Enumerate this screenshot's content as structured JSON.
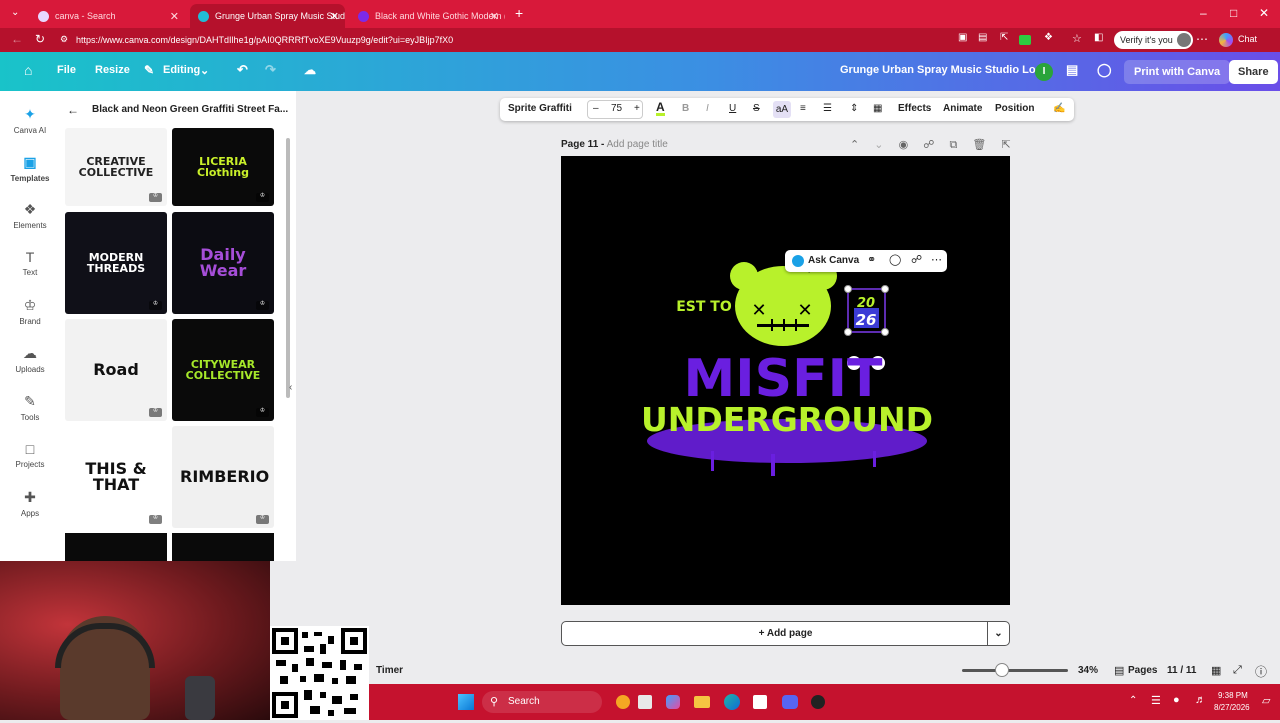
{
  "browser": {
    "tabs": [
      {
        "title": "canva - Search",
        "active": false,
        "favicon_color": "#e8d6ff"
      },
      {
        "title": "Grunge Urban Spray Music Studio Lo",
        "active": true,
        "favicon_color": "#21bcd6"
      },
      {
        "title": "Black and White Gothic Modern (",
        "active": false,
        "favicon_color": "#7d2ae8"
      }
    ],
    "new_tab_icon": "+",
    "url": "https://www.canva.com/design/DAHTdIlhe1g/pAI0QRRRfTvoXE9Vuuzp9g/edit?ui=eyJBIjp7fX0",
    "verify_label": "Verify it's you",
    "chat_label": "Chat"
  },
  "header": {
    "file": "File",
    "resize": "Resize",
    "editing": "Editing",
    "title": "Grunge Urban Spray Music Studio Logo",
    "avatar_initial": "I",
    "print": "Print with Canva",
    "share": "Share"
  },
  "rail": [
    {
      "label": "Canva AI",
      "icon": "canva-ai-icon"
    },
    {
      "label": "Templates",
      "icon": "templates-icon"
    },
    {
      "label": "Elements",
      "icon": "elements-icon"
    },
    {
      "label": "Text",
      "icon": "text-icon"
    },
    {
      "label": "Brand",
      "icon": "brand-icon"
    },
    {
      "label": "Uploads",
      "icon": "uploads-icon"
    },
    {
      "label": "Tools",
      "icon": "tools-icon"
    },
    {
      "label": "Projects",
      "icon": "projects-icon"
    },
    {
      "label": "Apps",
      "icon": "apps-icon"
    }
  ],
  "panel": {
    "title": "Black and Neon Green Graffiti Street Fa...",
    "thumbs": [
      {
        "text": "CREATIVE COLLECTIVE",
        "bg": "#f4f4f4",
        "fg": "#222222"
      },
      {
        "text": "LICERIA Clothing",
        "bg": "#0a0a0a",
        "fg": "#c9f02a"
      },
      {
        "text": "MODERN THREADS",
        "bg": "#101018",
        "fg": "#ffffff"
      },
      {
        "text": "Daily Wear",
        "bg": "#0c0c12",
        "fg": "#a64ed8"
      },
      {
        "text": "Road",
        "bg": "#f2f2f2",
        "fg": "#111111"
      },
      {
        "text": "CITYWEAR COLLECTIVE",
        "bg": "#0a0a0a",
        "fg": "#a6e82a"
      },
      {
        "text": "THIS & THAT",
        "bg": "#ffffff",
        "fg": "#111111"
      },
      {
        "text": "RIMBERIO",
        "bg": "#f0f0f0",
        "fg": "#111111"
      }
    ]
  },
  "toolbar": {
    "font": "Sprite Graffiti",
    "size": "75",
    "minus": "–",
    "plus": "+",
    "effects": "Effects",
    "animate": "Animate",
    "position": "Position"
  },
  "page": {
    "label": "Page 11 -",
    "title_placeholder": "Add page title",
    "add_page": "+ Add page"
  },
  "design": {
    "est": "EST TO",
    "year_top": "20",
    "year_bottom": "26",
    "misfit": "MISFIT",
    "underground": "UNDERGROUND",
    "ask_canva": "Ask Canva"
  },
  "footer": {
    "timer": "Timer",
    "zoom": "34%",
    "zoom_level": 0.34,
    "pages_label": "Pages",
    "pages_count": "11 / 11"
  },
  "taskbar": {
    "search": "Search",
    "time": "9:38 PM",
    "date": "8/27/2026"
  },
  "colors": {
    "neon_green": "#b8f12b",
    "purple": "#6a1fe0",
    "selection": "#7c3aed"
  }
}
